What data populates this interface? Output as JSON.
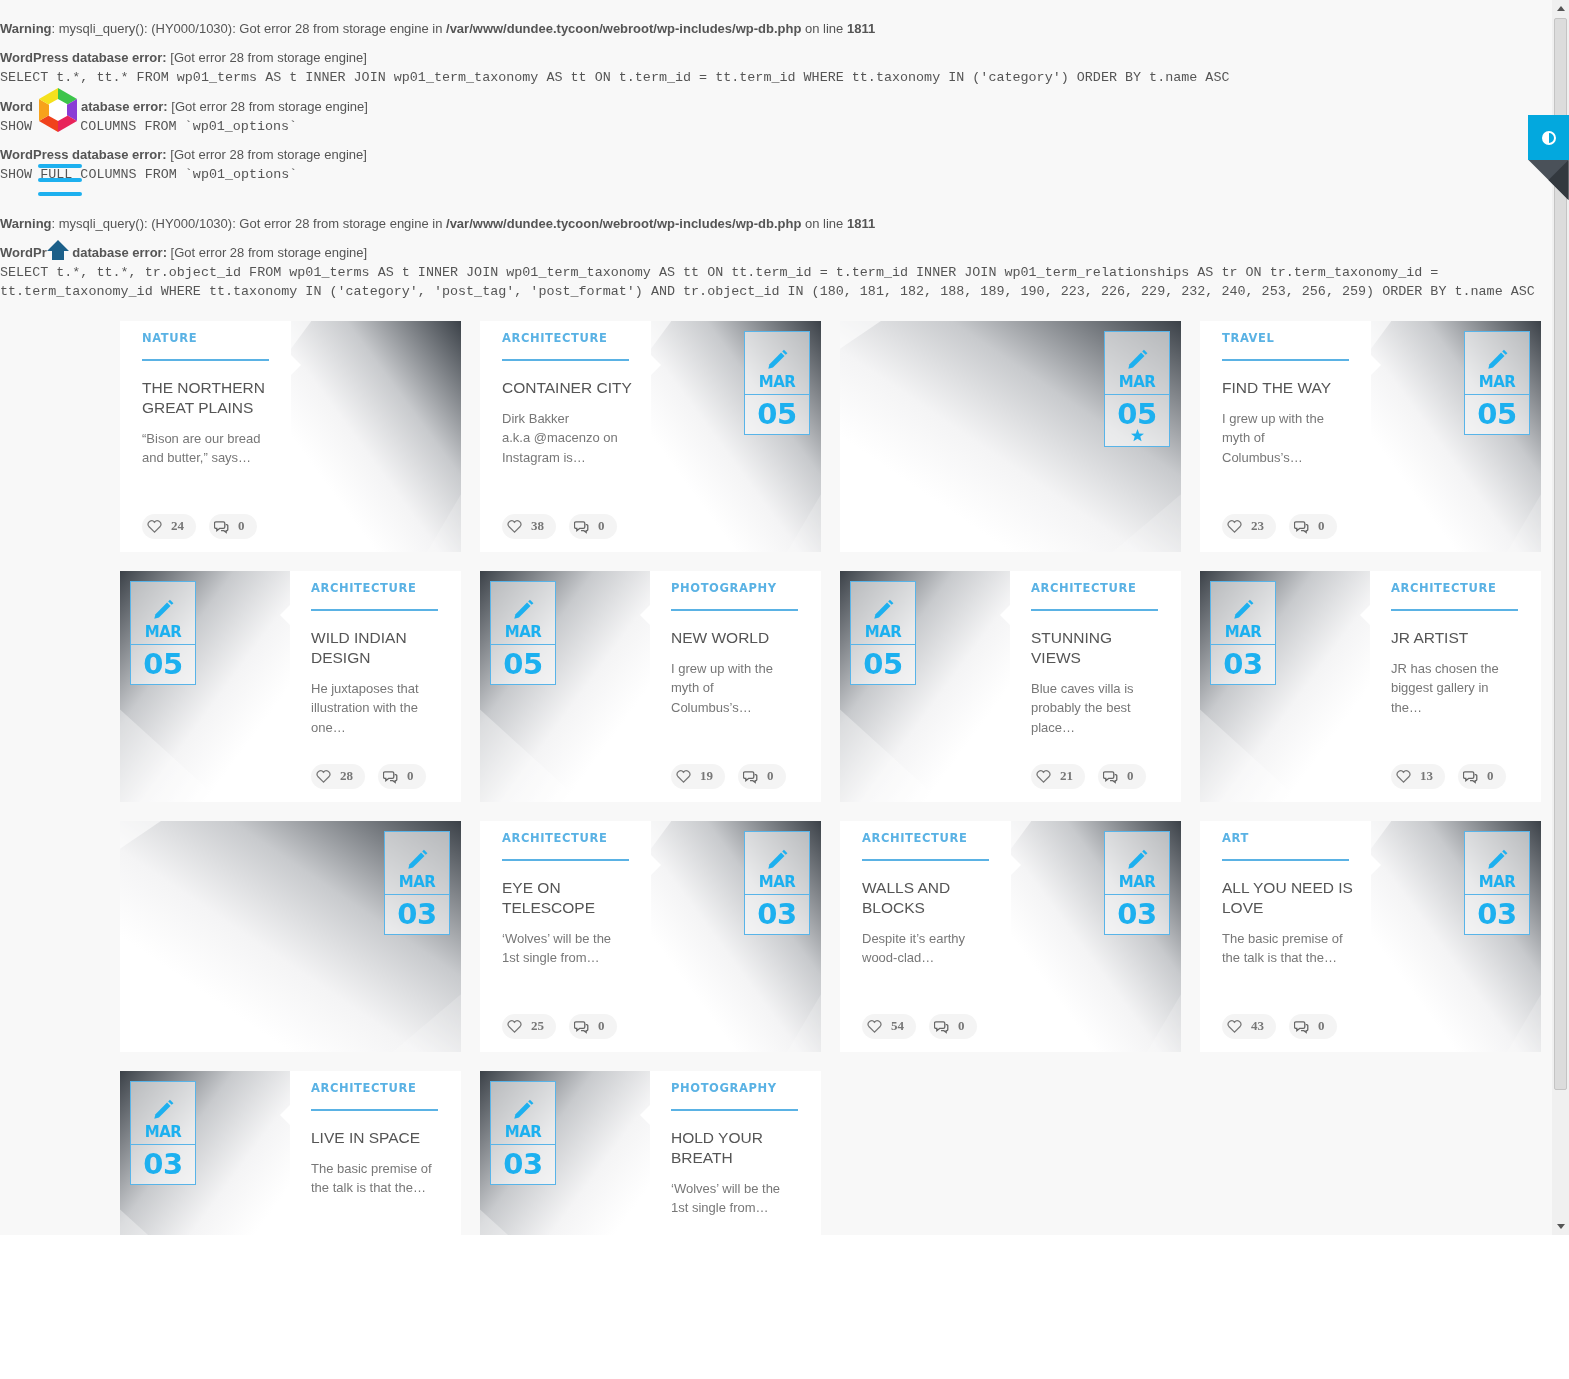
{
  "errors": [
    {
      "kind": "warning",
      "message": "**Warning**: mysqli_query(): (HY000/1030): Got error 28 from storage engine in **/var/www/dundee.tycoon/webroot/wp-includes/wp-db.php** on line **1811**"
    },
    {
      "kind": "db",
      "label": "WordPress database error:",
      "message": "[Got error 28 from storage engine]",
      "query": "SELECT t.*, tt.* FROM wp01_terms AS t INNER JOIN wp01_term_taxonomy AS tt ON t.term_id = tt.term_id WHERE tt.taxonomy IN ('category') ORDER BY t.name ASC"
    },
    {
      "kind": "db",
      "label": [
        "Word",
        "atabase error:"
      ],
      "message": "[Got error 28 from storage engine]",
      "query": [
        "SHOW",
        "COLUMNS FROM `wp01_options`"
      ]
    },
    {
      "kind": "db",
      "label": "WordPress database error:",
      "message": "[Got error 28 from storage engine]",
      "query": "SHOW FULL COLUMNS FROM `wp01_options`"
    },
    {
      "kind": "warning",
      "message": "**Warning**: mysqli_query(): (HY000/1030): Got error 28 from storage engine in **/var/www/dundee.tycoon/webroot/wp-includes/wp-db.php** on line **1811**"
    },
    {
      "kind": "db",
      "label": [
        "WordPr",
        " database error:"
      ],
      "message": "[Got error 28 from storage engine]",
      "query": "SELECT t.*, tt.*, tr.object_id FROM wp01_terms AS t INNER JOIN wp01_term_taxonomy AS tt ON tt.term_id = t.term_id INNER JOIN wp01_term_relationships AS tr ON tr.term_taxonomy_id = tt.term_taxonomy_id WHERE tt.taxonomy IN ('category', 'post_tag', 'post_format') AND tr.object_id IN (180, 181, 182, 188, 189, 190, 223, 226, 229, 232, 240, 253, 256, 259) ORDER BY t.name ASC"
    }
  ],
  "posts": [
    {
      "kind": "text-left",
      "category": "NATURE",
      "title": "THE NORTHERN\nGREAT PLAINS",
      "excerpt": "“Bison are our bread\nand butter,” says…",
      "likes": "24",
      "comments": "0"
    },
    {
      "kind": "text-left",
      "category": "ARCHITECTURE",
      "title": "CONTAINER CITY",
      "excerpt": "Dirk Bakker\na.k.a @macenzo on\nInstagram is…",
      "likes": "38",
      "comments": "0",
      "date": {
        "month": "MAR",
        "day": "05"
      },
      "featured": false
    },
    {
      "kind": "image-only",
      "date": {
        "month": "MAR",
        "day": "05"
      },
      "featured": true
    },
    {
      "kind": "text-left",
      "category": "TRAVEL",
      "title": "FIND THE WAY",
      "excerpt": "I grew up with the\nmyth of\nColumbus’s…",
      "likes": "23",
      "comments": "0",
      "date": {
        "month": "MAR",
        "day": "05"
      },
      "featured": false
    },
    {
      "kind": "image-left",
      "category": "ARCHITECTURE",
      "title": "WILD INDIAN\nDESIGN",
      "excerpt": "He juxtaposes that\nillustration with the\none…",
      "likes": "28",
      "comments": "0",
      "date": {
        "month": "MAR",
        "day": "05"
      },
      "featured": false
    },
    {
      "kind": "image-left",
      "category": "PHOTOGRAPHY",
      "title": "NEW WORLD",
      "excerpt": "I grew up with the\nmyth of\nColumbus’s…",
      "likes": "19",
      "comments": "0",
      "date": {
        "month": "MAR",
        "day": "05"
      },
      "featured": false
    },
    {
      "kind": "image-left",
      "category": "ARCHITECTURE",
      "title": "STUNNING\nVIEWS",
      "excerpt": "Blue caves villa is\nprobably the best\nplace…",
      "likes": "21",
      "comments": "0",
      "date": {
        "month": "MAR",
        "day": "05"
      },
      "featured": false
    },
    {
      "kind": "image-left",
      "category": "ARCHITECTURE",
      "title": "JR ARTIST",
      "excerpt": "JR has chosen the\nbiggest gallery in\nthe…",
      "likes": "13",
      "comments": "0",
      "date": {
        "month": "MAR",
        "day": "03"
      },
      "featured": false
    },
    {
      "kind": "image-only",
      "date": {
        "month": "MAR",
        "day": "03"
      },
      "featured": false
    },
    {
      "kind": "text-left",
      "category": "ARCHITECTURE",
      "title": "EYE ON\nTELESCOPE",
      "excerpt": "‘Wolves’ will be the\n1st single from…",
      "likes": "25",
      "comments": "0",
      "date": {
        "month": "MAR",
        "day": "03"
      },
      "featured": false
    },
    {
      "kind": "text-left",
      "category": "ARCHITECTURE",
      "title": "WALLS AND\nBLOCKS",
      "excerpt": "Despite it’s earthy\nwood-clad…",
      "likes": "54",
      "comments": "0",
      "date": {
        "month": "MAR",
        "day": "03"
      },
      "featured": false
    },
    {
      "kind": "text-left",
      "category": "ART",
      "title": "ALL YOU NEED IS\nLOVE",
      "excerpt": "The basic premise of\nthe talk is that the…",
      "likes": "43",
      "comments": "0",
      "date": {
        "month": "MAR",
        "day": "03"
      },
      "featured": false
    },
    {
      "kind": "image-left",
      "category": "ARCHITECTURE",
      "title": "LIVE IN SPACE",
      "excerpt": "The basic premise of\nthe talk is that the…",
      "date": {
        "month": "MAR",
        "day": "03"
      },
      "featured": false
    },
    {
      "kind": "image-left",
      "category": "PHOTOGRAPHY",
      "title": "HOLD YOUR\nBREATH",
      "excerpt": "‘Wolves’ will be the\n1st single from…",
      "date": {
        "month": "MAR",
        "day": "03"
      },
      "featured": false
    }
  ]
}
